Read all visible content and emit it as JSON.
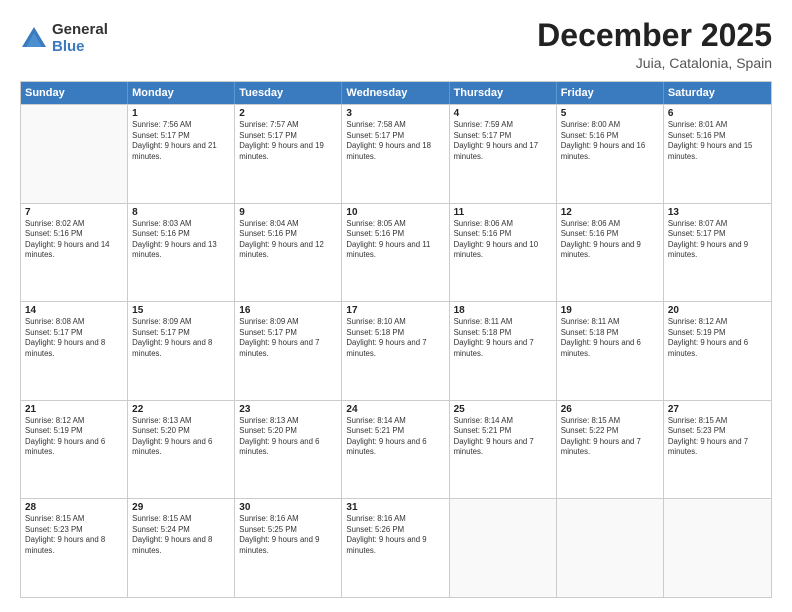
{
  "logo": {
    "general": "General",
    "blue": "Blue"
  },
  "title": "December 2025",
  "location": "Juia, Catalonia, Spain",
  "days": [
    "Sunday",
    "Monday",
    "Tuesday",
    "Wednesday",
    "Thursday",
    "Friday",
    "Saturday"
  ],
  "weeks": [
    [
      {
        "date": "",
        "sunrise": "",
        "sunset": "",
        "daylight": "",
        "empty": true
      },
      {
        "date": "1",
        "sunrise": "Sunrise: 7:56 AM",
        "sunset": "Sunset: 5:17 PM",
        "daylight": "Daylight: 9 hours and 21 minutes."
      },
      {
        "date": "2",
        "sunrise": "Sunrise: 7:57 AM",
        "sunset": "Sunset: 5:17 PM",
        "daylight": "Daylight: 9 hours and 19 minutes."
      },
      {
        "date": "3",
        "sunrise": "Sunrise: 7:58 AM",
        "sunset": "Sunset: 5:17 PM",
        "daylight": "Daylight: 9 hours and 18 minutes."
      },
      {
        "date": "4",
        "sunrise": "Sunrise: 7:59 AM",
        "sunset": "Sunset: 5:17 PM",
        "daylight": "Daylight: 9 hours and 17 minutes."
      },
      {
        "date": "5",
        "sunrise": "Sunrise: 8:00 AM",
        "sunset": "Sunset: 5:16 PM",
        "daylight": "Daylight: 9 hours and 16 minutes."
      },
      {
        "date": "6",
        "sunrise": "Sunrise: 8:01 AM",
        "sunset": "Sunset: 5:16 PM",
        "daylight": "Daylight: 9 hours and 15 minutes."
      }
    ],
    [
      {
        "date": "7",
        "sunrise": "Sunrise: 8:02 AM",
        "sunset": "Sunset: 5:16 PM",
        "daylight": "Daylight: 9 hours and 14 minutes."
      },
      {
        "date": "8",
        "sunrise": "Sunrise: 8:03 AM",
        "sunset": "Sunset: 5:16 PM",
        "daylight": "Daylight: 9 hours and 13 minutes."
      },
      {
        "date": "9",
        "sunrise": "Sunrise: 8:04 AM",
        "sunset": "Sunset: 5:16 PM",
        "daylight": "Daylight: 9 hours and 12 minutes."
      },
      {
        "date": "10",
        "sunrise": "Sunrise: 8:05 AM",
        "sunset": "Sunset: 5:16 PM",
        "daylight": "Daylight: 9 hours and 11 minutes."
      },
      {
        "date": "11",
        "sunrise": "Sunrise: 8:06 AM",
        "sunset": "Sunset: 5:16 PM",
        "daylight": "Daylight: 9 hours and 10 minutes."
      },
      {
        "date": "12",
        "sunrise": "Sunrise: 8:06 AM",
        "sunset": "Sunset: 5:16 PM",
        "daylight": "Daylight: 9 hours and 9 minutes."
      },
      {
        "date": "13",
        "sunrise": "Sunrise: 8:07 AM",
        "sunset": "Sunset: 5:17 PM",
        "daylight": "Daylight: 9 hours and 9 minutes."
      }
    ],
    [
      {
        "date": "14",
        "sunrise": "Sunrise: 8:08 AM",
        "sunset": "Sunset: 5:17 PM",
        "daylight": "Daylight: 9 hours and 8 minutes."
      },
      {
        "date": "15",
        "sunrise": "Sunrise: 8:09 AM",
        "sunset": "Sunset: 5:17 PM",
        "daylight": "Daylight: 9 hours and 8 minutes."
      },
      {
        "date": "16",
        "sunrise": "Sunrise: 8:09 AM",
        "sunset": "Sunset: 5:17 PM",
        "daylight": "Daylight: 9 hours and 7 minutes."
      },
      {
        "date": "17",
        "sunrise": "Sunrise: 8:10 AM",
        "sunset": "Sunset: 5:18 PM",
        "daylight": "Daylight: 9 hours and 7 minutes."
      },
      {
        "date": "18",
        "sunrise": "Sunrise: 8:11 AM",
        "sunset": "Sunset: 5:18 PM",
        "daylight": "Daylight: 9 hours and 7 minutes."
      },
      {
        "date": "19",
        "sunrise": "Sunrise: 8:11 AM",
        "sunset": "Sunset: 5:18 PM",
        "daylight": "Daylight: 9 hours and 6 minutes."
      },
      {
        "date": "20",
        "sunrise": "Sunrise: 8:12 AM",
        "sunset": "Sunset: 5:19 PM",
        "daylight": "Daylight: 9 hours and 6 minutes."
      }
    ],
    [
      {
        "date": "21",
        "sunrise": "Sunrise: 8:12 AM",
        "sunset": "Sunset: 5:19 PM",
        "daylight": "Daylight: 9 hours and 6 minutes."
      },
      {
        "date": "22",
        "sunrise": "Sunrise: 8:13 AM",
        "sunset": "Sunset: 5:20 PM",
        "daylight": "Daylight: 9 hours and 6 minutes."
      },
      {
        "date": "23",
        "sunrise": "Sunrise: 8:13 AM",
        "sunset": "Sunset: 5:20 PM",
        "daylight": "Daylight: 9 hours and 6 minutes."
      },
      {
        "date": "24",
        "sunrise": "Sunrise: 8:14 AM",
        "sunset": "Sunset: 5:21 PM",
        "daylight": "Daylight: 9 hours and 6 minutes."
      },
      {
        "date": "25",
        "sunrise": "Sunrise: 8:14 AM",
        "sunset": "Sunset: 5:21 PM",
        "daylight": "Daylight: 9 hours and 7 minutes."
      },
      {
        "date": "26",
        "sunrise": "Sunrise: 8:15 AM",
        "sunset": "Sunset: 5:22 PM",
        "daylight": "Daylight: 9 hours and 7 minutes."
      },
      {
        "date": "27",
        "sunrise": "Sunrise: 8:15 AM",
        "sunset": "Sunset: 5:23 PM",
        "daylight": "Daylight: 9 hours and 7 minutes."
      }
    ],
    [
      {
        "date": "28",
        "sunrise": "Sunrise: 8:15 AM",
        "sunset": "Sunset: 5:23 PM",
        "daylight": "Daylight: 9 hours and 8 minutes."
      },
      {
        "date": "29",
        "sunrise": "Sunrise: 8:15 AM",
        "sunset": "Sunset: 5:24 PM",
        "daylight": "Daylight: 9 hours and 8 minutes."
      },
      {
        "date": "30",
        "sunrise": "Sunrise: 8:16 AM",
        "sunset": "Sunset: 5:25 PM",
        "daylight": "Daylight: 9 hours and 9 minutes."
      },
      {
        "date": "31",
        "sunrise": "Sunrise: 8:16 AM",
        "sunset": "Sunset: 5:26 PM",
        "daylight": "Daylight: 9 hours and 9 minutes."
      },
      {
        "date": "",
        "sunrise": "",
        "sunset": "",
        "daylight": "",
        "empty": true
      },
      {
        "date": "",
        "sunrise": "",
        "sunset": "",
        "daylight": "",
        "empty": true
      },
      {
        "date": "",
        "sunrise": "",
        "sunset": "",
        "daylight": "",
        "empty": true
      }
    ]
  ]
}
